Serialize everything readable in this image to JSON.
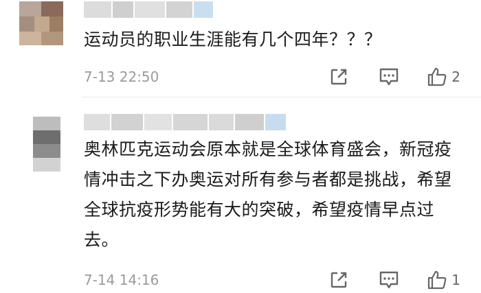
{
  "comments": [
    {
      "text": "运动员的职业生涯能有几个四年？？？",
      "time": "7-13 22:50",
      "likes": "2"
    },
    {
      "text": "奥林匹克运动会原本就是全球体育盛会，新冠疫情冲击之下办奥运对所有参与者都是挑战，希望全球抗疫形势能有大的突破，希望疫情早点过去。",
      "time": "7-14 14:16",
      "likes": "1"
    }
  ],
  "icons": {
    "share": "share-icon",
    "reply": "comment-icon",
    "like": "thumbs-up-icon"
  },
  "colors": {
    "text": "#1a1a1a",
    "meta": "#9a9a9a",
    "icon": "#666666",
    "name_blur": "#d7d7d7"
  }
}
